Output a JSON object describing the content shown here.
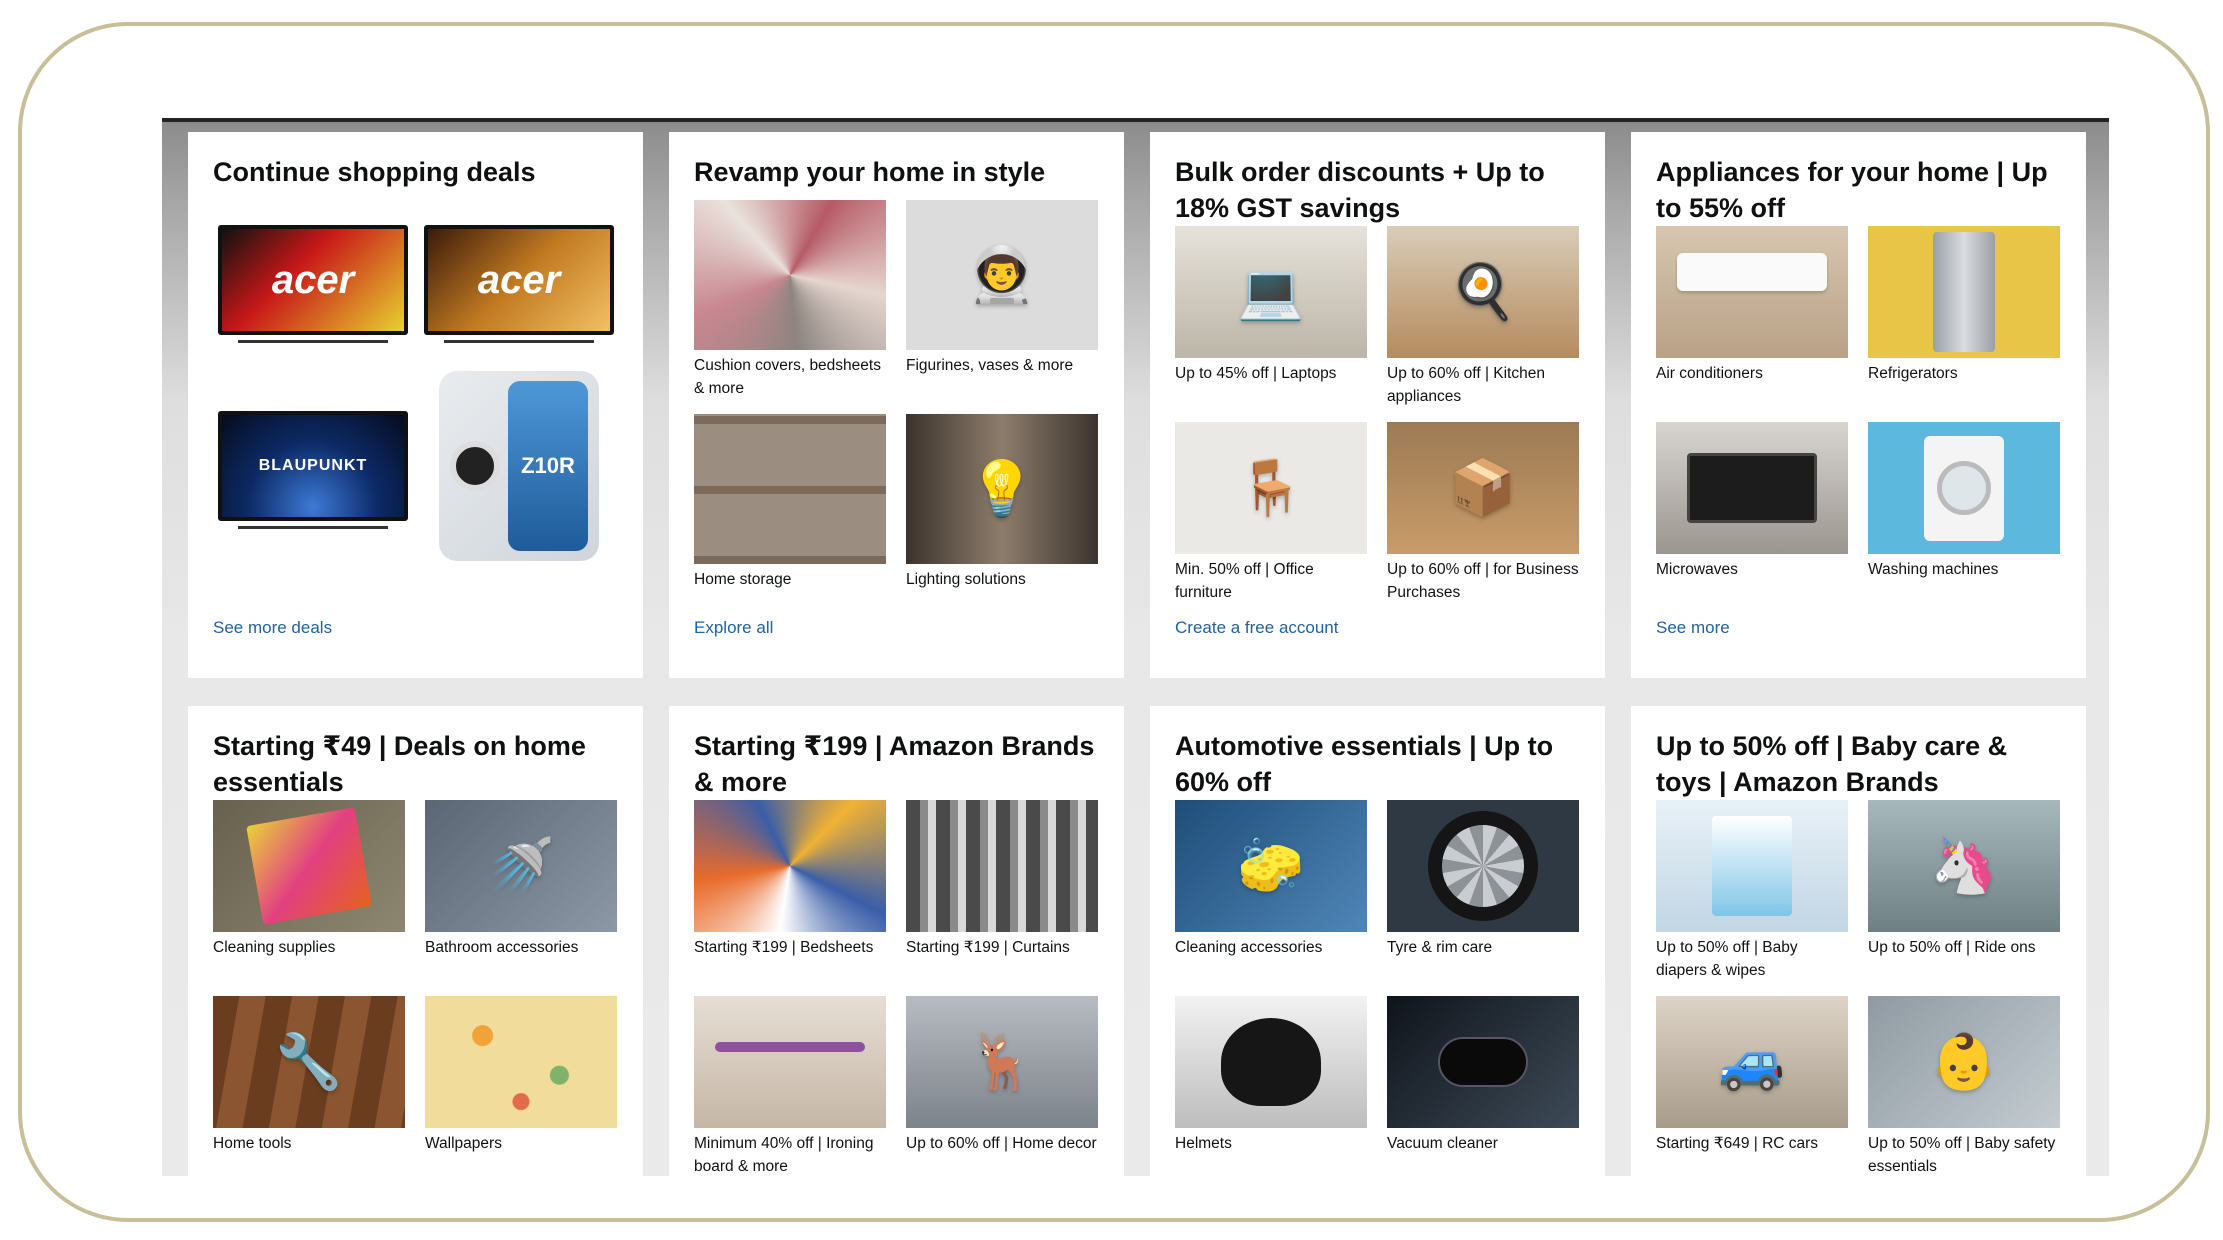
{
  "cards": [
    {
      "title": "Continue shopping deals",
      "link": "See more deals",
      "deals": [
        {
          "brand": "acer",
          "icon": "tv-icon",
          "color": "#c81818"
        },
        {
          "brand": "acer",
          "icon": "tv-icon",
          "color": "#c27a21"
        },
        {
          "brand": "BLAUPUNKT",
          "icon": "tv-icon",
          "color": "#0c2a66"
        },
        {
          "brand": "Z10R",
          "icon": "phone-icon",
          "color": "#3f86c9"
        }
      ]
    },
    {
      "title": "Revamp your home in style",
      "link": "Explore all",
      "tiles": [
        {
          "label": "Cushion covers, bedsheets & more",
          "icon": "rug-icon",
          "color": "#b65a66"
        },
        {
          "label": "Figurines, vases & more",
          "icon": "astronaut-icon",
          "color": "#d9d9d9"
        },
        {
          "label": "Home storage",
          "icon": "storage-icon",
          "color": "#8a7360"
        },
        {
          "label": "Lighting solutions",
          "icon": "lamp-icon",
          "color": "#6d6258"
        }
      ]
    },
    {
      "title": "Bulk order discounts + Up to 18% GST savings",
      "link": "Create a free account",
      "tiles": [
        {
          "label": "Up to 45% off | Laptops",
          "icon": "laptop-icon",
          "color": "#d8d3c9"
        },
        {
          "label": "Up to 60% off | Kitchen appliances",
          "icon": "airfryer-icon",
          "color": "#b58b5e"
        },
        {
          "label": "Min. 50% off | Office furniture",
          "icon": "chair-icon",
          "color": "#e7e5e1"
        },
        {
          "label": "Up to 60% off | for Business Purchases",
          "icon": "box-icon",
          "color": "#b08557"
        }
      ]
    },
    {
      "title": "Appliances for your home | Up to 55% off",
      "link": "See more",
      "tiles": [
        {
          "label": "Air conditioners",
          "icon": "ac-icon",
          "color": "#c9b49a"
        },
        {
          "label": "Refrigerators",
          "icon": "fridge-icon",
          "color": "#e8c547"
        },
        {
          "label": "Microwaves",
          "icon": "microwave-icon",
          "color": "#aaa6a1"
        },
        {
          "label": "Washing machines",
          "icon": "washer-icon",
          "color": "#5cb8dc"
        }
      ]
    },
    {
      "title": "Starting ₹49 | Deals on home essentials",
      "tiles": [
        {
          "label": "Cleaning supplies",
          "icon": "sponge-icon",
          "color": "#76705d"
        },
        {
          "label": "Bathroom accessories",
          "icon": "shower-icon",
          "color": "#697785"
        },
        {
          "label": "Home tools",
          "icon": "tools-icon",
          "color": "#7a4a2a"
        },
        {
          "label": "Wallpapers",
          "icon": "wallpaper-icon",
          "color": "#e5c97a"
        }
      ]
    },
    {
      "title": "Starting ₹199 | Amazon Brands & more",
      "tiles": [
        {
          "label": "Starting ₹199 | Bedsheets",
          "icon": "bed-icon",
          "color": "#3b5ea8"
        },
        {
          "label": "Starting ₹199 | Curtains",
          "icon": "curtain-icon",
          "color": "#6b6b6b"
        },
        {
          "label": "Minimum 40% off | Ironing board & more",
          "icon": "iron-icon",
          "color": "#cfc3b6"
        },
        {
          "label": "Up to 60% off | Home decor",
          "icon": "deer-icon",
          "color": "#8a8f96"
        }
      ]
    },
    {
      "title": "Automotive essentials | Up to 60% off",
      "tiles": [
        {
          "label": "Cleaning accessories",
          "icon": "car-wash-icon",
          "color": "#2b5f8f"
        },
        {
          "label": "Tyre & rim care",
          "icon": "tyre-icon",
          "color": "#3c4652"
        },
        {
          "label": "Helmets",
          "icon": "helmet-icon",
          "color": "#d4d4d4"
        },
        {
          "label": "Vacuum cleaner",
          "icon": "vacuum-icon",
          "color": "#1f2630"
        }
      ]
    },
    {
      "title": "Up to 50% off | Baby care & toys | Amazon Brands",
      "tiles": [
        {
          "label": "Up to 50% off | Baby diapers & wipes",
          "icon": "diaper-icon",
          "color": "#cfe3ef"
        },
        {
          "label": "Up to 50% off | Ride ons",
          "icon": "ride-on-icon",
          "color": "#8fa3a8"
        },
        {
          "label": "Starting ₹649 | RC cars",
          "icon": "rc-car-icon",
          "color": "#c2b8a8"
        },
        {
          "label": "Up to 50% off | Baby safety essentials",
          "icon": "car-seat-icon",
          "color": "#9aa4ab"
        }
      ]
    }
  ]
}
